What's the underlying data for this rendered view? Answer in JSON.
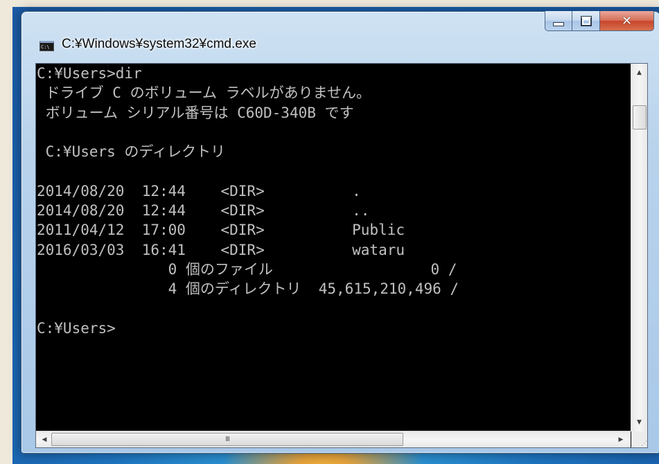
{
  "window": {
    "title": "C:¥Windows¥system32¥cmd.exe",
    "icon": "cmd-icon",
    "buttons": {
      "minimize": "minimize-icon",
      "maximize": "maximize-icon",
      "close": "close-icon"
    }
  },
  "console": {
    "lines": [
      "C:¥Users>dir",
      " ドライブ C のボリューム ラベルがありません。",
      " ボリューム シリアル番号は C60D-340B です",
      "",
      " C:¥Users のディレクトリ",
      "",
      "2014/08/20  12:44    <DIR>          .",
      "2014/08/20  12:44    <DIR>          ..",
      "2011/04/12  17:00    <DIR>          Public",
      "2016/03/03  16:41    <DIR>          wataru",
      "               0 個のファイル                  0 /",
      "               4 個のディレクトリ  45,615,210,496 /",
      "",
      "C:¥Users>"
    ]
  },
  "scrollbars": {
    "vertical_position": 0.1,
    "horizontal_position": 0.0
  },
  "colors": {
    "console_bg": "#000000",
    "console_text": "#c0c0c0",
    "close_button": "#c8452b",
    "title_frame": "#b9d3ec"
  }
}
